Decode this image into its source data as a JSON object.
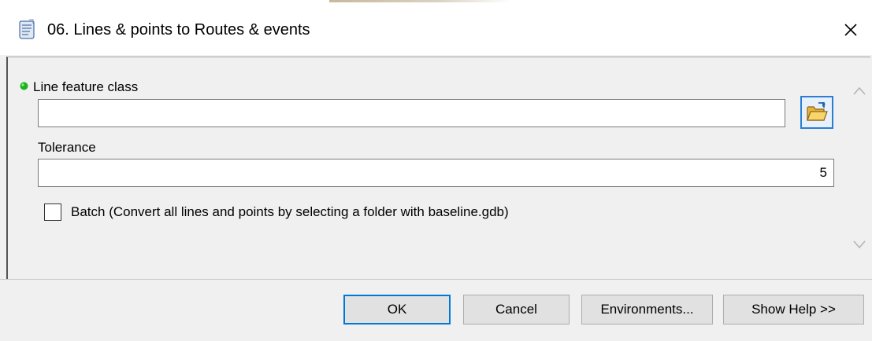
{
  "window": {
    "title": "06. Lines & points to Routes & events",
    "close_symbol": "✕",
    "icon": "script-tool-icon"
  },
  "form": {
    "line_feature_class": {
      "label": "Line feature class",
      "value": "",
      "required": true,
      "required_color": "#1db31d"
    },
    "tolerance": {
      "label": "Tolerance",
      "value": "5"
    },
    "batch": {
      "label": "Batch (Convert all lines and points by selecting a folder with baseline.gdb)",
      "checked": false
    }
  },
  "buttons": {
    "ok": "OK",
    "cancel": "Cancel",
    "environments": "Environments...",
    "show_help": "Show Help >>"
  },
  "colors": {
    "accent": "#0078d7",
    "background": "#f0f0f0"
  }
}
